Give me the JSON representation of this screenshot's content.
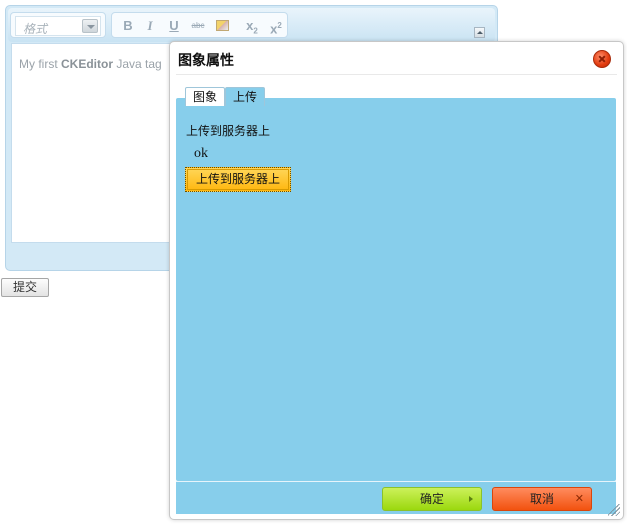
{
  "editor": {
    "format_label": "格式",
    "toolbar": {
      "bold": "B",
      "italic": "I",
      "underline": "U",
      "strike": "abc",
      "subscript_base": "x",
      "subscript_mark": "2",
      "superscript_base": "x",
      "superscript_mark": "2"
    },
    "content_prefix": "My first ",
    "content_bold": "CKEditor",
    "content_suffix": " Java tag"
  },
  "form": {
    "submit_label": "提交"
  },
  "dialog": {
    "title": "图象属性",
    "tabs": [
      {
        "label": "图象"
      },
      {
        "label": "上传"
      }
    ],
    "upload_label": "上传到服务器上",
    "status_text": "ok",
    "upload_button": "上传到服务器上",
    "ok_button": "确定",
    "cancel_button": "取消",
    "cancel_x": "✕"
  },
  "colors": {
    "panel": "#87ceeb",
    "ok_button": "#9bd80e",
    "cancel_button": "#f2520f",
    "upload_button": "#ffb60d"
  }
}
